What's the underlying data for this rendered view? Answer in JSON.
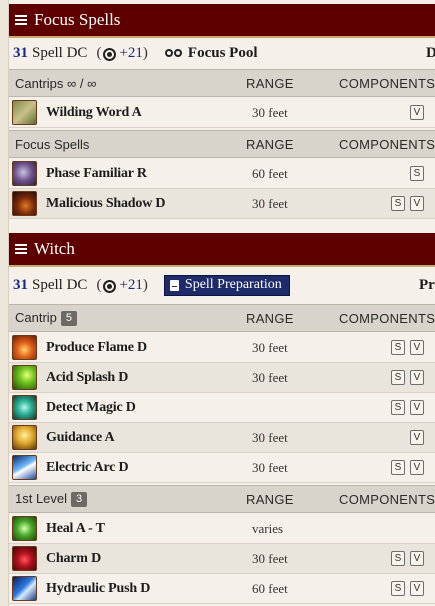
{
  "focus": {
    "title": "Focus Spells",
    "dc_value": "31",
    "dc_label": "Spell DC",
    "attack_value": "+21",
    "focus_pool_label": "Focus Pool",
    "trailing": "D",
    "cantrips_header": "Cantrips ∞ / ∞",
    "cantrips": [
      {
        "name": "Wilding Word A",
        "range": "30 feet",
        "components": [
          "V"
        ],
        "icon": "wilding-word-icon"
      }
    ],
    "spells_header": "Focus Spells",
    "spells": [
      {
        "name": "Phase Familiar R",
        "range": "60 feet",
        "components": [
          "S"
        ],
        "icon": "phase-familiar-icon"
      },
      {
        "name": "Malicious Shadow D",
        "range": "30 feet",
        "components": [
          "S",
          "V"
        ],
        "icon": "malicious-shadow-icon"
      }
    ]
  },
  "witch": {
    "title": "Witch",
    "dc_value": "31",
    "dc_label": "Spell DC",
    "attack_value": "+21",
    "prep_button": "Spell Preparation",
    "trailing": "Pr",
    "cantrip_header": "Cantrip",
    "cantrip_count": "5",
    "cantrips": [
      {
        "name": "Produce Flame D",
        "range": "30 feet",
        "components": [
          "S",
          "V"
        ],
        "icon": "flame-icon"
      },
      {
        "name": "Acid Splash D",
        "range": "30 feet",
        "components": [
          "S",
          "V"
        ],
        "icon": "acid-icon"
      },
      {
        "name": "Detect Magic D",
        "range": "",
        "components": [
          "S",
          "V"
        ],
        "icon": "detect-magic-icon"
      },
      {
        "name": "Guidance A",
        "range": "30 feet",
        "components": [
          "V"
        ],
        "icon": "guidance-icon"
      },
      {
        "name": "Electric Arc D",
        "range": "30 feet",
        "components": [
          "S",
          "V"
        ],
        "icon": "electric-arc-icon"
      }
    ],
    "level1_header": "1st Level",
    "level1_count": "3",
    "level1": [
      {
        "name": "Heal A - T",
        "range": "varies",
        "components": [],
        "icon": "heal-icon"
      },
      {
        "name": "Charm D",
        "range": "30 feet",
        "components": [
          "S",
          "V"
        ],
        "icon": "charm-icon"
      },
      {
        "name": "Hydraulic Push D",
        "range": "60 feet",
        "components": [
          "S",
          "V"
        ],
        "icon": "hydraulic-push-icon"
      }
    ]
  },
  "headers": {
    "range": "RANGE",
    "components": "COMPONENTS"
  }
}
